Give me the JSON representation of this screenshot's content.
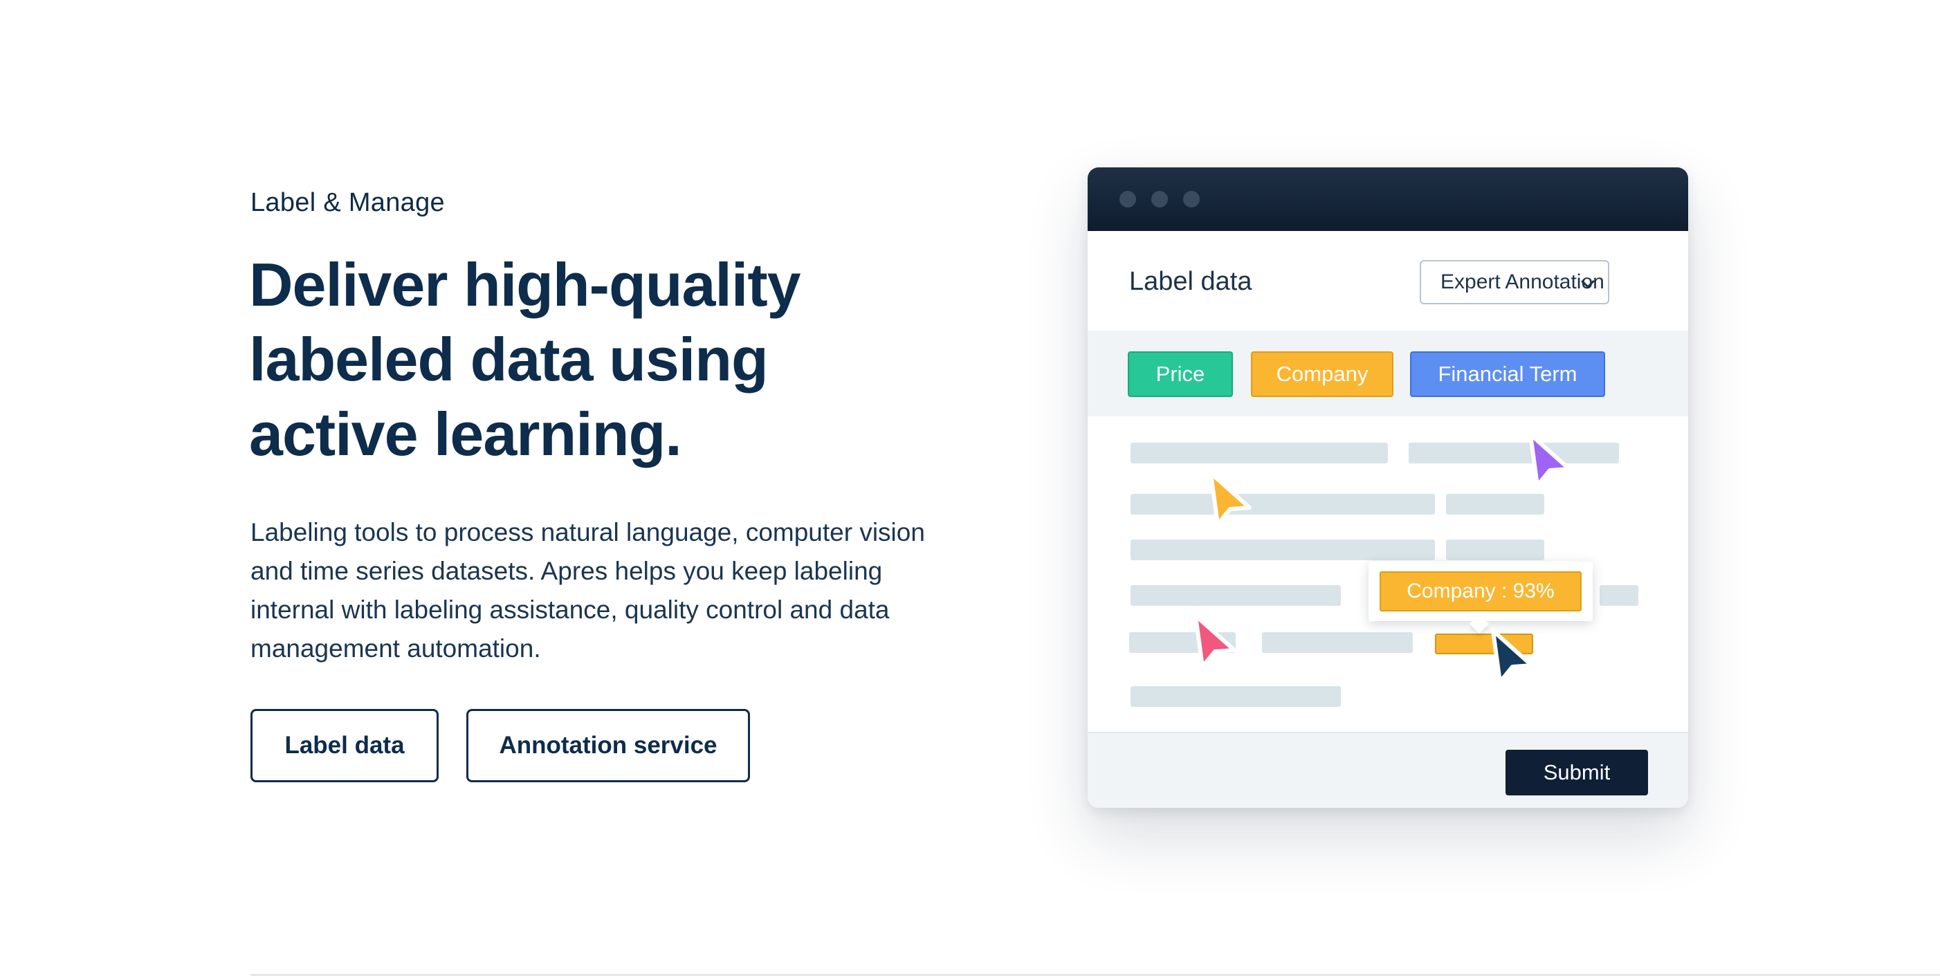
{
  "hero": {
    "eyebrow": "Label & Manage",
    "headline_lines": [
      "Deliver high-quality",
      "labeled data using",
      "active learning."
    ],
    "body": "Labeling tools to process natural language, computer vision and time series datasets. Apres helps you keep labeling internal with labeling assistance, quality control and data management automation.",
    "buttons": {
      "label_data": "Label data",
      "annotation_service": "Annotation service"
    }
  },
  "mock_window": {
    "title": "Label data",
    "dropdown_value": "Expert Annotation",
    "tags": [
      {
        "label": "Price",
        "color": "#27c797"
      },
      {
        "label": "Company",
        "color": "#fbb631"
      },
      {
        "label": "Financial Term",
        "color": "#5d8ef2"
      }
    ],
    "tooltip": "Company : 93%",
    "submit_label": "Submit",
    "cursors": [
      {
        "icon": "cursor-arrow-icon",
        "color": "#a064f5"
      },
      {
        "icon": "cursor-arrow-icon",
        "color": "#fbb631"
      },
      {
        "icon": "cursor-arrow-icon",
        "color": "#f2577e"
      },
      {
        "icon": "cursor-arrow-icon",
        "color": "#163a5e"
      }
    ]
  },
  "colors": {
    "navy": "#0e2c4b",
    "window_bar": "#0e1c2f",
    "placeholder_text_bar": "#d9e4e8"
  }
}
